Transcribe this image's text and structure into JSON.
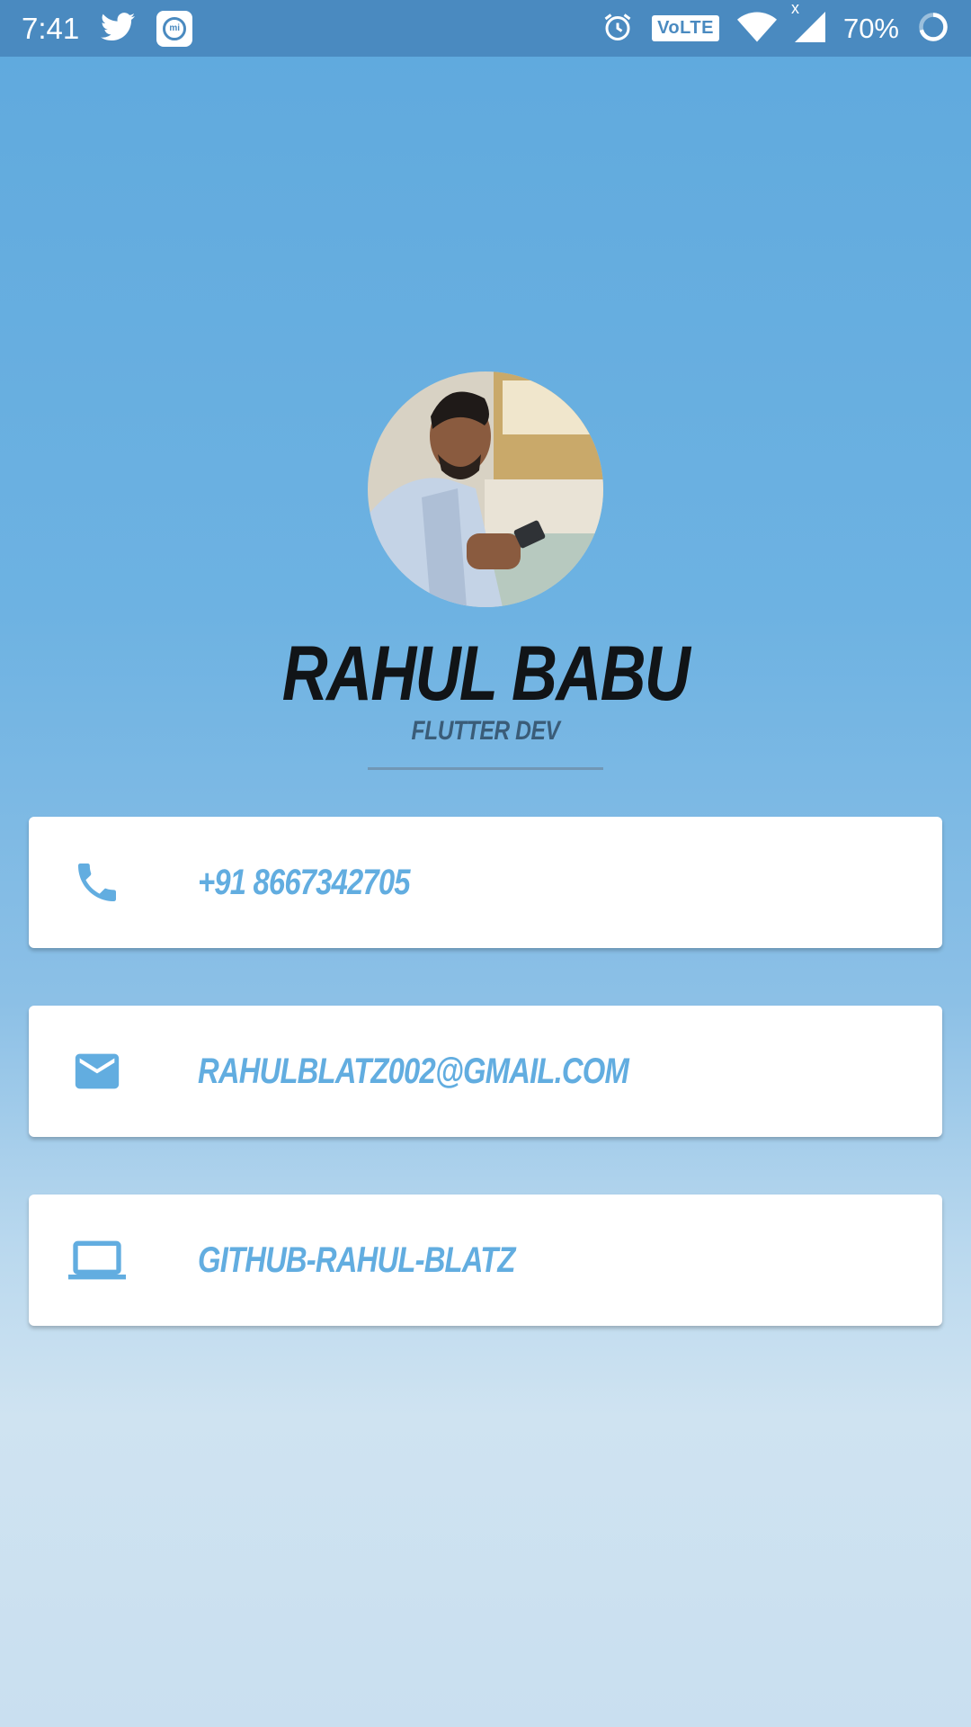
{
  "status_bar": {
    "time": "7:41",
    "volte": "VoLTE",
    "network_indicator": "x",
    "battery": "70%"
  },
  "profile": {
    "name": "RAHUL BABU",
    "title": "FLUTTER DEV"
  },
  "contacts": [
    {
      "icon": "phone-icon",
      "text": "+91 8667342705"
    },
    {
      "icon": "mail-icon",
      "text": "RAHULBLATZ002@GMAIL.COM"
    },
    {
      "icon": "laptop-icon",
      "text": "GITHUB-RAHUL-BLATZ"
    }
  ],
  "colors": {
    "accent": "#62ade0",
    "status_bar": "#4a8ac0",
    "name_text": "#111417"
  }
}
